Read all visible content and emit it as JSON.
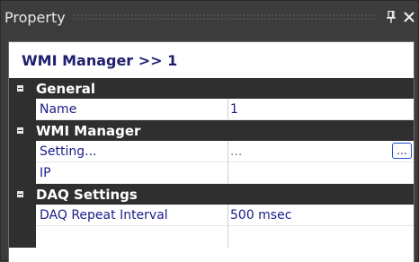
{
  "panel": {
    "title": "Property",
    "pin_glyph": "Ԅ",
    "close_glyph": "✕"
  },
  "header": {
    "title": "WMI Manager >> 1"
  },
  "categories": [
    {
      "label": "General",
      "rows": [
        {
          "name": "Name",
          "value": "1"
        }
      ]
    },
    {
      "label": "WMI Manager",
      "rows": [
        {
          "name": "Setting...",
          "value": "...",
          "button": "..."
        },
        {
          "name": "IP",
          "value": ""
        }
      ]
    },
    {
      "label": "DAQ Settings",
      "rows": [
        {
          "name": "DAQ Repeat Interval",
          "value": "500 msec"
        }
      ]
    }
  ],
  "colors": {
    "panel_bg": "#3c3c3c",
    "category_bg": "#2f2f2f",
    "text_blue": "#1c1c8a",
    "header_text": "#1f1f6e"
  }
}
